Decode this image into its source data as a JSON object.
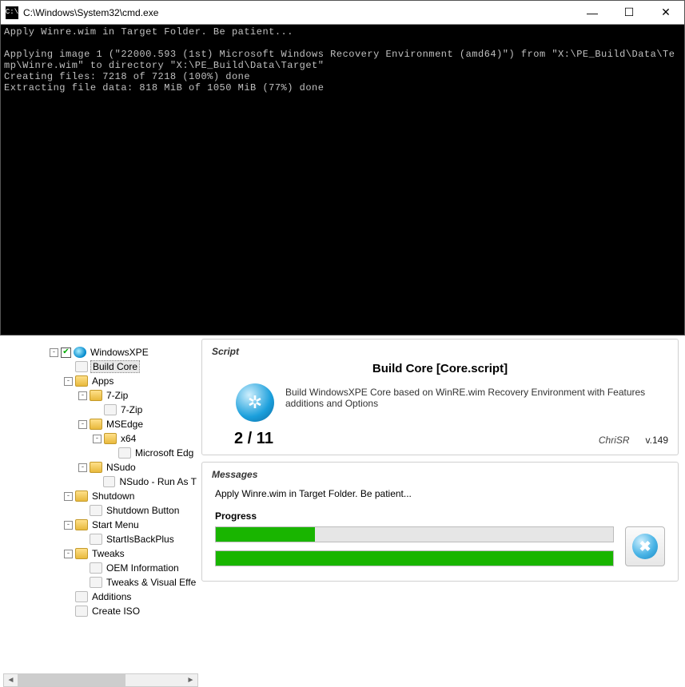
{
  "cmd": {
    "title": "C:\\Windows\\System32\\cmd.exe",
    "icon_label": "C:\\",
    "lines": [
      "Apply Winre.wim in Target Folder. Be patient...",
      "",
      "Applying image 1 (\"22000.593 (1st) Microsoft Windows Recovery Environment (amd64)\") from \"X:\\PE_Build\\Data\\Temp\\Winre.wim\" to directory \"X:\\PE_Build\\Data\\Target\"",
      "Creating files: 7218 of 7218 (100%) done",
      "Extracting file data: 818 MiB of 1050 MiB (77%) done"
    ]
  },
  "tree": {
    "items": [
      {
        "indent": 0,
        "exp": "-",
        "chk": true,
        "icon": "globe",
        "label": "WindowsXPE"
      },
      {
        "indent": 1,
        "exp": "",
        "icon": "file",
        "label": "Build Core",
        "selected": true
      },
      {
        "indent": 1,
        "exp": "-",
        "icon": "folder",
        "label": "Apps"
      },
      {
        "indent": 2,
        "exp": "-",
        "icon": "folder",
        "label": "7-Zip"
      },
      {
        "indent": 3,
        "exp": "",
        "icon": "file",
        "label": "7-Zip"
      },
      {
        "indent": 2,
        "exp": "-",
        "icon": "folder",
        "label": "MSEdge"
      },
      {
        "indent": 3,
        "exp": "-",
        "icon": "folder",
        "label": "x64"
      },
      {
        "indent": 4,
        "exp": "",
        "icon": "file",
        "label": "Microsoft Edg"
      },
      {
        "indent": 2,
        "exp": "-",
        "icon": "folder",
        "label": "NSudo"
      },
      {
        "indent": 3,
        "exp": "",
        "icon": "file",
        "label": "NSudo - Run As T"
      },
      {
        "indent": 1,
        "exp": "-",
        "icon": "folder",
        "label": "Shutdown"
      },
      {
        "indent": 2,
        "exp": "",
        "icon": "file",
        "label": "Shutdown Button"
      },
      {
        "indent": 1,
        "exp": "-",
        "icon": "folder",
        "label": "Start Menu"
      },
      {
        "indent": 2,
        "exp": "",
        "icon": "file",
        "label": "StartIsBackPlus"
      },
      {
        "indent": 1,
        "exp": "-",
        "icon": "folder",
        "label": "Tweaks"
      },
      {
        "indent": 2,
        "exp": "",
        "icon": "file",
        "label": "OEM Information"
      },
      {
        "indent": 2,
        "exp": "",
        "icon": "file",
        "label": "Tweaks & Visual Effe"
      },
      {
        "indent": 1,
        "exp": "",
        "icon": "file",
        "label": "Additions"
      },
      {
        "indent": 1,
        "exp": "",
        "icon": "file",
        "label": "Create ISO"
      }
    ]
  },
  "script": {
    "section": "Script",
    "title": "Build Core [Core.script]",
    "desc": "Build WindowsXPE Core based on WinRE.wim Recovery Environment with Features additions and Options",
    "counter": "2 / 11",
    "author": "ChriSR",
    "version": "v.149"
  },
  "messages": {
    "section": "Messages",
    "text": "Apply Winre.wim in Target Folder. Be patient...",
    "progress_label": "Progress",
    "progress1_pct": 25,
    "progress2_pct": 100
  }
}
